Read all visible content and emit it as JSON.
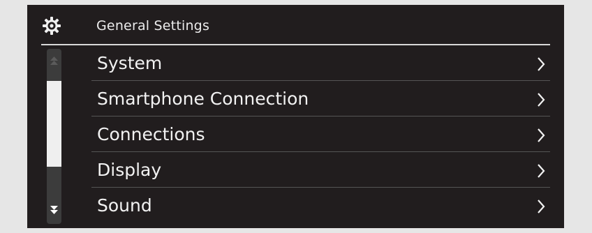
{
  "header": {
    "icon": "gear-icon",
    "title": "General Settings"
  },
  "scrollbar": {
    "up_icon": "scroll-up-icon",
    "down_icon": "scroll-down-icon"
  },
  "menu": {
    "chevron_icon": "chevron-right-icon",
    "items": [
      {
        "label": "System"
      },
      {
        "label": "Smartphone Connection"
      },
      {
        "label": "Connections"
      },
      {
        "label": "Display"
      },
      {
        "label": "Sound"
      }
    ]
  },
  "colors": {
    "screen_background": "#211d1e",
    "frame_background": "#e6e6e6",
    "text": "#f2f2f2",
    "scroll_thumb": "#efefef",
    "scroll_track": "#3c3c3c"
  }
}
